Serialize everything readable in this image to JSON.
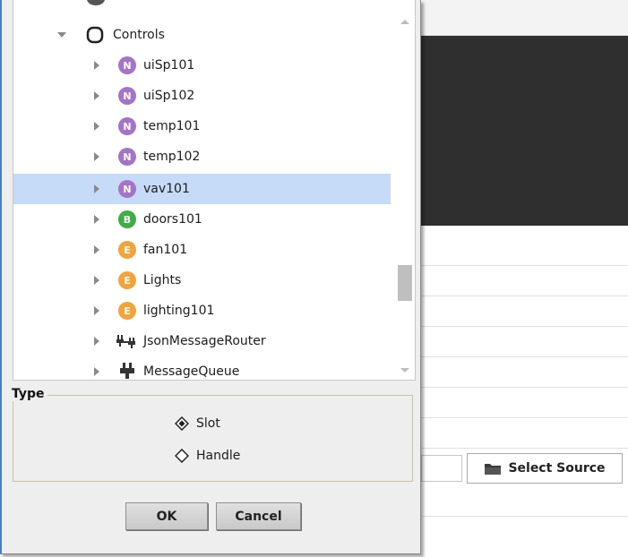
{
  "tree": {
    "root": {
      "label": "Controls",
      "expanded": true,
      "icon": "folder-round-icon"
    },
    "items": [
      {
        "label": "uiSp101",
        "badge": "N",
        "badge_color": "#a574c9",
        "icon": "numeric-point-icon",
        "selected": false
      },
      {
        "label": "uiSp102",
        "badge": "N",
        "badge_color": "#a574c9",
        "icon": "numeric-point-icon",
        "selected": false
      },
      {
        "label": "temp101",
        "badge": "N",
        "badge_color": "#a574c9",
        "icon": "numeric-point-icon",
        "selected": false
      },
      {
        "label": "temp102",
        "badge": "N",
        "badge_color": "#a574c9",
        "icon": "numeric-point-icon",
        "selected": false
      },
      {
        "label": "vav101",
        "badge": "N",
        "badge_color": "#a574c9",
        "icon": "numeric-point-icon",
        "selected": true
      },
      {
        "label": "doors101",
        "badge": "B",
        "badge_color": "#3fae49",
        "icon": "boolean-point-icon",
        "selected": false
      },
      {
        "label": "fan101",
        "badge": "E",
        "badge_color": "#f2a43a",
        "icon": "enum-point-icon",
        "selected": false
      },
      {
        "label": "Lights",
        "badge": "E",
        "badge_color": "#f2a43a",
        "icon": "enum-point-icon",
        "selected": false
      },
      {
        "label": "lighting101",
        "badge": "E",
        "badge_color": "#f2a43a",
        "icon": "enum-point-icon",
        "selected": false
      },
      {
        "label": "JsonMessageRouter",
        "badge": "",
        "badge_color": "#444444",
        "icon": "router-plug-icon",
        "selected": false
      },
      {
        "label": "MessageQueue",
        "badge": "",
        "badge_color": "#444444",
        "icon": "plug-icon",
        "selected": false
      }
    ]
  },
  "type_group": {
    "legend": "Type",
    "options": [
      {
        "label": "Slot",
        "checked": true
      },
      {
        "label": "Handle",
        "checked": false
      }
    ]
  },
  "buttons": {
    "ok": "OK",
    "cancel": "Cancel"
  },
  "background": {
    "select_source_label": "Select Source"
  },
  "colors": {
    "selection": "#c6dbf8",
    "dialog_bg": "#eeeeee",
    "dark_panel": "#2f2f2f"
  }
}
